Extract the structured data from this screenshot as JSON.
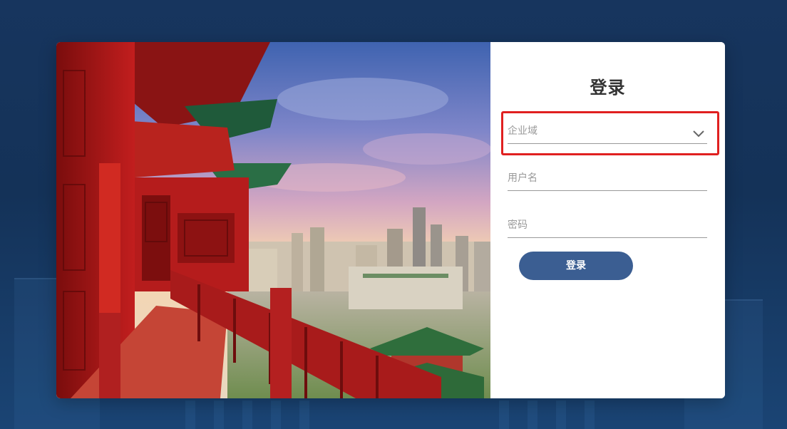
{
  "login": {
    "title": "登录",
    "domain_placeholder": "企业域",
    "username_placeholder": "用户名",
    "password_placeholder": "密码",
    "submit_label": "登录"
  },
  "icons": {
    "domain_dropdown": "chevron-down-icon"
  },
  "colors": {
    "page_background": "#17355e",
    "button": "#3b5e92",
    "highlight": "#e02020"
  }
}
